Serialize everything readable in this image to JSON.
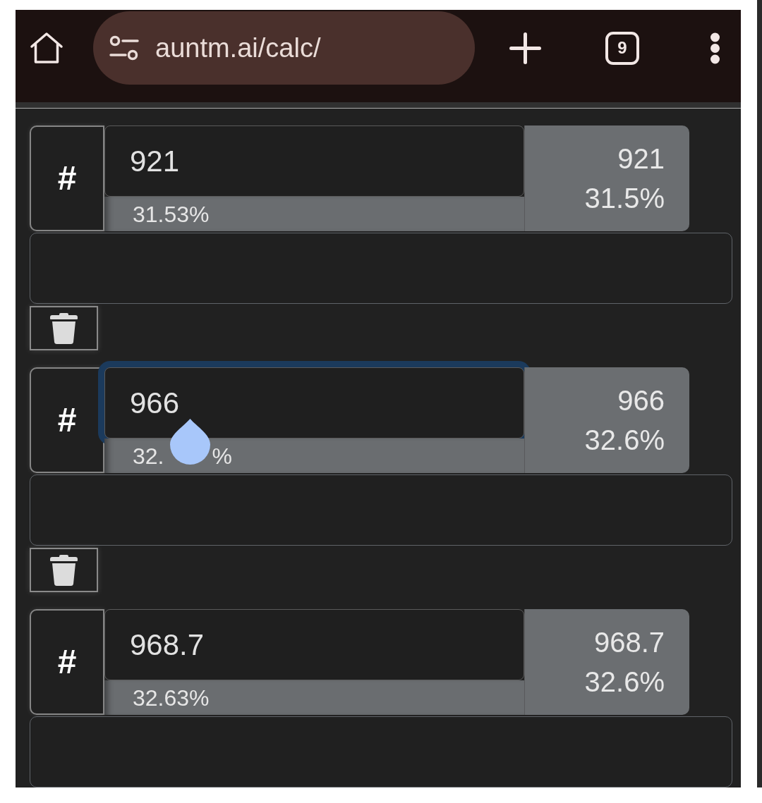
{
  "browser_toolbar": {
    "url": "auntm.ai/calc/",
    "tab_count": "9"
  },
  "blocks": [
    {
      "kind": "entry",
      "symbol": "#",
      "value": "921",
      "focused": false,
      "percent": "31.53%",
      "result_value": "921",
      "result_percent": "31.5%"
    },
    {
      "kind": "note"
    },
    {
      "kind": "delete"
    },
    {
      "kind": "entry",
      "symbol": "#",
      "value": "966",
      "focused": true,
      "percent": "32.",
      "percent_tail": "%",
      "result_value": "966",
      "result_percent": "32.6%"
    },
    {
      "kind": "note"
    },
    {
      "kind": "delete"
    },
    {
      "kind": "entry",
      "symbol": "#",
      "value": "968.7",
      "focused": false,
      "percent": "32.63%",
      "result_value": "968.7",
      "result_percent": "32.6%"
    },
    {
      "kind": "note"
    }
  ]
}
